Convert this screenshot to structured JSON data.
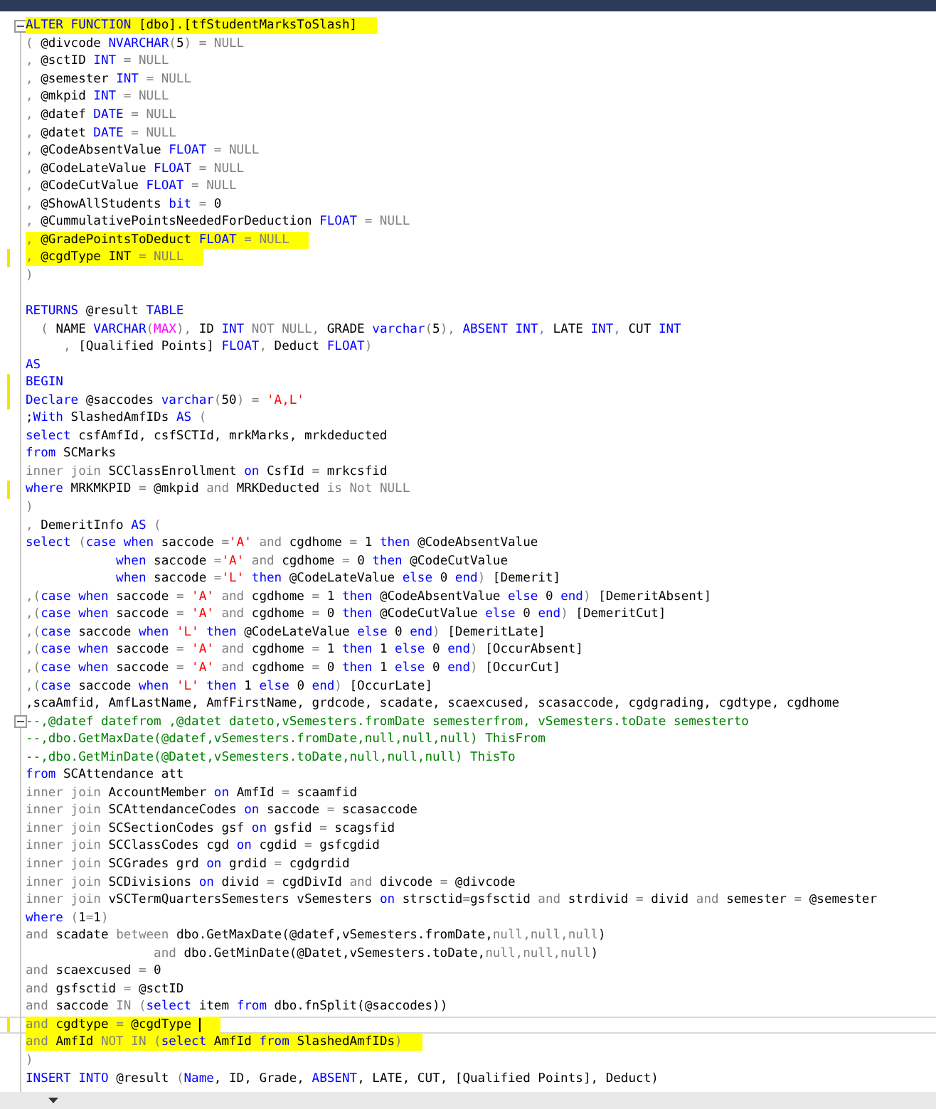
{
  "editor": {
    "lines": [
      {
        "highlighted": true,
        "changed": false,
        "current": false,
        "foldable": true,
        "tokens": [
          {
            "kind": "kw",
            "text": "ALTER FUNCTION"
          },
          {
            "kind": "plain",
            "text": " [dbo].[tfStudentMarksToSlash]"
          }
        ]
      },
      {
        "highlighted": false,
        "changed": false,
        "current": false,
        "foldable": false,
        "tokens": [
          {
            "kind": "gray",
            "text": "( "
          },
          {
            "kind": "plain",
            "text": "@divcode "
          },
          {
            "kind": "kw",
            "text": "NVARCHAR"
          },
          {
            "kind": "gray",
            "text": "("
          },
          {
            "kind": "plain",
            "text": "5"
          },
          {
            "kind": "gray",
            "text": ") = NULL"
          }
        ]
      },
      {
        "highlighted": false,
        "changed": false,
        "current": false,
        "foldable": false,
        "tokens": [
          {
            "kind": "gray",
            "text": ", "
          },
          {
            "kind": "plain",
            "text": "@sctID "
          },
          {
            "kind": "kw",
            "text": "INT"
          },
          {
            "kind": "gray",
            "text": " = NULL"
          }
        ]
      },
      {
        "highlighted": false,
        "changed": false,
        "current": false,
        "foldable": false,
        "tokens": [
          {
            "kind": "gray",
            "text": ", "
          },
          {
            "kind": "plain",
            "text": "@semester "
          },
          {
            "kind": "kw",
            "text": "INT"
          },
          {
            "kind": "gray",
            "text": " = NULL"
          }
        ]
      },
      {
        "highlighted": false,
        "changed": false,
        "current": false,
        "foldable": false,
        "tokens": [
          {
            "kind": "gray",
            "text": ", "
          },
          {
            "kind": "plain",
            "text": "@mkpid "
          },
          {
            "kind": "kw",
            "text": "INT"
          },
          {
            "kind": "gray",
            "text": " = NULL"
          }
        ]
      },
      {
        "highlighted": false,
        "changed": false,
        "current": false,
        "foldable": false,
        "tokens": [
          {
            "kind": "gray",
            "text": ", "
          },
          {
            "kind": "plain",
            "text": "@datef "
          },
          {
            "kind": "kw",
            "text": "DATE"
          },
          {
            "kind": "gray",
            "text": " = NULL"
          }
        ]
      },
      {
        "highlighted": false,
        "changed": false,
        "current": false,
        "foldable": false,
        "tokens": [
          {
            "kind": "gray",
            "text": ", "
          },
          {
            "kind": "plain",
            "text": "@datet "
          },
          {
            "kind": "kw",
            "text": "DATE"
          },
          {
            "kind": "gray",
            "text": " = NULL"
          }
        ]
      },
      {
        "highlighted": false,
        "changed": false,
        "current": false,
        "foldable": false,
        "tokens": [
          {
            "kind": "gray",
            "text": ", "
          },
          {
            "kind": "plain",
            "text": "@CodeAbsentValue "
          },
          {
            "kind": "kw",
            "text": "FLOAT"
          },
          {
            "kind": "gray",
            "text": " = NULL"
          }
        ]
      },
      {
        "highlighted": false,
        "changed": false,
        "current": false,
        "foldable": false,
        "tokens": [
          {
            "kind": "gray",
            "text": ", "
          },
          {
            "kind": "plain",
            "text": "@CodeLateValue "
          },
          {
            "kind": "kw",
            "text": "FLOAT"
          },
          {
            "kind": "gray",
            "text": " = NULL"
          }
        ]
      },
      {
        "highlighted": false,
        "changed": false,
        "current": false,
        "foldable": false,
        "tokens": [
          {
            "kind": "gray",
            "text": ", "
          },
          {
            "kind": "plain",
            "text": "@CodeCutValue "
          },
          {
            "kind": "kw",
            "text": "FLOAT"
          },
          {
            "kind": "gray",
            "text": " = NULL"
          }
        ]
      },
      {
        "highlighted": false,
        "changed": false,
        "current": false,
        "foldable": false,
        "tokens": [
          {
            "kind": "gray",
            "text": ", "
          },
          {
            "kind": "plain",
            "text": "@ShowAllStudents "
          },
          {
            "kind": "kw",
            "text": "bit"
          },
          {
            "kind": "gray",
            "text": " = "
          },
          {
            "kind": "plain",
            "text": "0"
          }
        ]
      },
      {
        "highlighted": false,
        "changed": false,
        "current": false,
        "foldable": false,
        "tokens": [
          {
            "kind": "gray",
            "text": ", "
          },
          {
            "kind": "plain",
            "text": "@CummulativePointsNeededForDeduction "
          },
          {
            "kind": "kw",
            "text": "FLOAT"
          },
          {
            "kind": "gray",
            "text": " = NULL"
          }
        ]
      },
      {
        "highlighted": true,
        "changed": false,
        "current": false,
        "foldable": false,
        "tokens": [
          {
            "kind": "gray",
            "text": ", "
          },
          {
            "kind": "plain",
            "text": "@GradePointsToDeduct "
          },
          {
            "kind": "kw",
            "text": "FLOAT"
          },
          {
            "kind": "gray",
            "text": " = NULL"
          }
        ]
      },
      {
        "highlighted": true,
        "changed": true,
        "current": false,
        "foldable": false,
        "tokens": [
          {
            "kind": "gray",
            "text": ", "
          },
          {
            "kind": "plain",
            "text": "@cgdType INT"
          },
          {
            "kind": "gray",
            "text": " = NULL"
          }
        ]
      },
      {
        "highlighted": false,
        "changed": false,
        "current": false,
        "foldable": false,
        "tokens": [
          {
            "kind": "gray",
            "text": ")"
          }
        ]
      },
      {
        "changed": false,
        "current": false,
        "foldable": false
      },
      {
        "highlighted": false,
        "changed": false,
        "current": false,
        "foldable": false,
        "tokens": [
          {
            "kind": "kw",
            "text": "RETURNS "
          },
          {
            "kind": "plain",
            "text": "@result "
          },
          {
            "kind": "kw",
            "text": "TABLE"
          }
        ]
      },
      {
        "highlighted": false,
        "changed": false,
        "current": false,
        "foldable": false,
        "tokens": [
          {
            "kind": "gray",
            "text": "  ( "
          },
          {
            "kind": "plain",
            "text": "NAME "
          },
          {
            "kind": "kw",
            "text": "VARCHAR"
          },
          {
            "kind": "gray",
            "text": "("
          },
          {
            "kind": "fn",
            "text": "MAX"
          },
          {
            "kind": "gray",
            "text": "), "
          },
          {
            "kind": "plain",
            "text": "ID "
          },
          {
            "kind": "kw",
            "text": "INT "
          },
          {
            "kind": "gray",
            "text": "NOT NULL, "
          },
          {
            "kind": "plain",
            "text": "GRADE "
          },
          {
            "kind": "kw",
            "text": "varchar"
          },
          {
            "kind": "gray",
            "text": "("
          },
          {
            "kind": "plain",
            "text": "5"
          },
          {
            "kind": "gray",
            "text": "), "
          },
          {
            "kind": "kw",
            "text": "ABSENT INT"
          },
          {
            "kind": "gray",
            "text": ", "
          },
          {
            "kind": "plain",
            "text": "LATE "
          },
          {
            "kind": "kw",
            "text": "INT"
          },
          {
            "kind": "gray",
            "text": ", "
          },
          {
            "kind": "plain",
            "text": "CUT "
          },
          {
            "kind": "kw",
            "text": "INT"
          }
        ]
      },
      {
        "highlighted": false,
        "changed": false,
        "current": false,
        "foldable": false,
        "tokens": [
          {
            "kind": "gray",
            "text": "     , "
          },
          {
            "kind": "plain",
            "text": "[Qualified Points] "
          },
          {
            "kind": "kw",
            "text": "FLOAT"
          },
          {
            "kind": "gray",
            "text": ", "
          },
          {
            "kind": "plain",
            "text": "Deduct "
          },
          {
            "kind": "kw",
            "text": "FLOAT"
          },
          {
            "kind": "gray",
            "text": ")"
          }
        ]
      },
      {
        "highlighted": false,
        "changed": false,
        "current": false,
        "foldable": false,
        "tokens": [
          {
            "kind": "kw",
            "text": "AS"
          }
        ]
      },
      {
        "highlighted": false,
        "changed": true,
        "current": false,
        "foldable": false,
        "tokens": [
          {
            "kind": "kw",
            "text": "BEGIN"
          }
        ]
      },
      {
        "highlighted": false,
        "changed": true,
        "current": false,
        "foldable": false,
        "tokens": [
          {
            "kind": "kw",
            "text": "Declare "
          },
          {
            "kind": "plain",
            "text": "@saccodes "
          },
          {
            "kind": "kw",
            "text": "varchar"
          },
          {
            "kind": "gray",
            "text": "("
          },
          {
            "kind": "plain",
            "text": "50"
          },
          {
            "kind": "gray",
            "text": ") = "
          },
          {
            "kind": "str",
            "text": "'A,L'"
          }
        ]
      },
      {
        "highlighted": false,
        "changed": false,
        "current": false,
        "foldable": false,
        "tokens": [
          {
            "kind": "plain",
            "text": ";"
          },
          {
            "kind": "kw",
            "text": "With "
          },
          {
            "kind": "plain",
            "text": "SlashedAmfIDs "
          },
          {
            "kind": "kw",
            "text": "AS "
          },
          {
            "kind": "gray",
            "text": "("
          }
        ]
      },
      {
        "highlighted": false,
        "changed": false,
        "current": false,
        "foldable": false,
        "tokens": [
          {
            "kind": "kw",
            "text": "select "
          },
          {
            "kind": "plain",
            "text": "csfAmfId, csfSCTId, mrkMarks, mrkdeducted"
          }
        ]
      },
      {
        "highlighted": false,
        "changed": false,
        "current": false,
        "foldable": false,
        "tokens": [
          {
            "kind": "kw",
            "text": "from "
          },
          {
            "kind": "plain",
            "text": "SCMarks"
          }
        ]
      },
      {
        "highlighted": false,
        "changed": false,
        "current": false,
        "foldable": false,
        "tokens": [
          {
            "kind": "gray",
            "text": "inner join "
          },
          {
            "kind": "plain",
            "text": "SCClassEnrollment "
          },
          {
            "kind": "kw",
            "text": "on "
          },
          {
            "kind": "plain",
            "text": "CsfId "
          },
          {
            "kind": "gray",
            "text": "= "
          },
          {
            "kind": "plain",
            "text": "mrkcsfid"
          }
        ]
      },
      {
        "highlighted": false,
        "changed": true,
        "current": false,
        "foldable": false,
        "tokens": [
          {
            "kind": "kw",
            "text": "where "
          },
          {
            "kind": "plain",
            "text": "MRKMKPID "
          },
          {
            "kind": "gray",
            "text": "= "
          },
          {
            "kind": "plain",
            "text": "@mkpid "
          },
          {
            "kind": "gray",
            "text": "and "
          },
          {
            "kind": "plain",
            "text": "MRKDeducted "
          },
          {
            "kind": "gray",
            "text": "is Not NULL"
          }
        ]
      },
      {
        "highlighted": false,
        "changed": false,
        "current": false,
        "foldable": false,
        "tokens": [
          {
            "kind": "gray",
            "text": ")"
          }
        ]
      },
      {
        "highlighted": false,
        "changed": false,
        "current": false,
        "foldable": false,
        "tokens": [
          {
            "kind": "gray",
            "text": ", "
          },
          {
            "kind": "plain",
            "text": "DemeritInfo "
          },
          {
            "kind": "kw",
            "text": "AS "
          },
          {
            "kind": "gray",
            "text": "("
          }
        ]
      },
      {
        "highlighted": false,
        "changed": false,
        "current": false,
        "foldable": false,
        "tokens": [
          {
            "kind": "kw",
            "text": "select "
          },
          {
            "kind": "gray",
            "text": "("
          },
          {
            "kind": "kw",
            "text": "case when "
          },
          {
            "kind": "plain",
            "text": "saccode "
          },
          {
            "kind": "gray",
            "text": "="
          },
          {
            "kind": "str",
            "text": "'A' "
          },
          {
            "kind": "gray",
            "text": "and "
          },
          {
            "kind": "plain",
            "text": "cgdhome "
          },
          {
            "kind": "gray",
            "text": "= "
          },
          {
            "kind": "plain",
            "text": "1 "
          },
          {
            "kind": "kw",
            "text": "then "
          },
          {
            "kind": "plain",
            "text": "@CodeAbsentValue"
          }
        ]
      },
      {
        "highlighted": false,
        "changed": false,
        "current": false,
        "foldable": false,
        "tokens": [
          {
            "kind": "kw",
            "text": "            when "
          },
          {
            "kind": "plain",
            "text": "saccode "
          },
          {
            "kind": "gray",
            "text": "="
          },
          {
            "kind": "str",
            "text": "'A' "
          },
          {
            "kind": "gray",
            "text": "and "
          },
          {
            "kind": "plain",
            "text": "cgdhome "
          },
          {
            "kind": "gray",
            "text": "= "
          },
          {
            "kind": "plain",
            "text": "0 "
          },
          {
            "kind": "kw",
            "text": "then "
          },
          {
            "kind": "plain",
            "text": "@CodeCutValue"
          }
        ]
      },
      {
        "highlighted": false,
        "changed": false,
        "current": false,
        "foldable": false,
        "tokens": [
          {
            "kind": "kw",
            "text": "            when "
          },
          {
            "kind": "plain",
            "text": "saccode "
          },
          {
            "kind": "gray",
            "text": "="
          },
          {
            "kind": "str",
            "text": "'L' "
          },
          {
            "kind": "kw",
            "text": "then "
          },
          {
            "kind": "plain",
            "text": "@CodeLateValue "
          },
          {
            "kind": "kw",
            "text": "else "
          },
          {
            "kind": "plain",
            "text": "0 "
          },
          {
            "kind": "kw",
            "text": "end"
          },
          {
            "kind": "gray",
            "text": ") "
          },
          {
            "kind": "plain",
            "text": "[Demerit]"
          }
        ]
      },
      {
        "highlighted": false,
        "changed": false,
        "current": false,
        "foldable": false,
        "tokens": [
          {
            "kind": "gray",
            "text": ",("
          },
          {
            "kind": "kw",
            "text": "case when "
          },
          {
            "kind": "plain",
            "text": "saccode "
          },
          {
            "kind": "gray",
            "text": "= "
          },
          {
            "kind": "str",
            "text": "'A' "
          },
          {
            "kind": "gray",
            "text": "and "
          },
          {
            "kind": "plain",
            "text": "cgdhome "
          },
          {
            "kind": "gray",
            "text": "= "
          },
          {
            "kind": "plain",
            "text": "1 "
          },
          {
            "kind": "kw",
            "text": "then "
          },
          {
            "kind": "plain",
            "text": "@CodeAbsentValue "
          },
          {
            "kind": "kw",
            "text": "else "
          },
          {
            "kind": "plain",
            "text": "0 "
          },
          {
            "kind": "kw",
            "text": "end"
          },
          {
            "kind": "gray",
            "text": ") "
          },
          {
            "kind": "plain",
            "text": "[DemeritAbsent]"
          }
        ]
      },
      {
        "highlighted": false,
        "changed": false,
        "current": false,
        "foldable": false,
        "tokens": [
          {
            "kind": "gray",
            "text": ",("
          },
          {
            "kind": "kw",
            "text": "case when "
          },
          {
            "kind": "plain",
            "text": "saccode "
          },
          {
            "kind": "gray",
            "text": "= "
          },
          {
            "kind": "str",
            "text": "'A' "
          },
          {
            "kind": "gray",
            "text": "and "
          },
          {
            "kind": "plain",
            "text": "cgdhome "
          },
          {
            "kind": "gray",
            "text": "= "
          },
          {
            "kind": "plain",
            "text": "0 "
          },
          {
            "kind": "kw",
            "text": "then "
          },
          {
            "kind": "plain",
            "text": "@CodeCutValue "
          },
          {
            "kind": "kw",
            "text": "else "
          },
          {
            "kind": "plain",
            "text": "0 "
          },
          {
            "kind": "kw",
            "text": "end"
          },
          {
            "kind": "gray",
            "text": ") "
          },
          {
            "kind": "plain",
            "text": "[DemeritCut]"
          }
        ]
      },
      {
        "highlighted": false,
        "changed": false,
        "current": false,
        "foldable": false,
        "tokens": [
          {
            "kind": "gray",
            "text": ",("
          },
          {
            "kind": "kw",
            "text": "case "
          },
          {
            "kind": "plain",
            "text": "saccode "
          },
          {
            "kind": "kw",
            "text": "when "
          },
          {
            "kind": "str",
            "text": "'L' "
          },
          {
            "kind": "kw",
            "text": "then "
          },
          {
            "kind": "plain",
            "text": "@CodeLateValue "
          },
          {
            "kind": "kw",
            "text": "else "
          },
          {
            "kind": "plain",
            "text": "0 "
          },
          {
            "kind": "kw",
            "text": "end"
          },
          {
            "kind": "gray",
            "text": ") "
          },
          {
            "kind": "plain",
            "text": "[DemeritLate]"
          }
        ]
      },
      {
        "highlighted": false,
        "changed": false,
        "current": false,
        "foldable": false,
        "tokens": [
          {
            "kind": "gray",
            "text": ",("
          },
          {
            "kind": "kw",
            "text": "case when "
          },
          {
            "kind": "plain",
            "text": "saccode "
          },
          {
            "kind": "gray",
            "text": "= "
          },
          {
            "kind": "str",
            "text": "'A' "
          },
          {
            "kind": "gray",
            "text": "and "
          },
          {
            "kind": "plain",
            "text": "cgdhome "
          },
          {
            "kind": "gray",
            "text": "= "
          },
          {
            "kind": "plain",
            "text": "1 "
          },
          {
            "kind": "kw",
            "text": "then "
          },
          {
            "kind": "plain",
            "text": "1 "
          },
          {
            "kind": "kw",
            "text": "else "
          },
          {
            "kind": "plain",
            "text": "0 "
          },
          {
            "kind": "kw",
            "text": "end"
          },
          {
            "kind": "gray",
            "text": ") "
          },
          {
            "kind": "plain",
            "text": "[OccurAbsent]"
          }
        ]
      },
      {
        "highlighted": false,
        "changed": false,
        "current": false,
        "foldable": false,
        "tokens": [
          {
            "kind": "gray",
            "text": ",("
          },
          {
            "kind": "kw",
            "text": "case when "
          },
          {
            "kind": "plain",
            "text": "saccode "
          },
          {
            "kind": "gray",
            "text": "= "
          },
          {
            "kind": "str",
            "text": "'A' "
          },
          {
            "kind": "gray",
            "text": "and "
          },
          {
            "kind": "plain",
            "text": "cgdhome "
          },
          {
            "kind": "gray",
            "text": "= "
          },
          {
            "kind": "plain",
            "text": "0 "
          },
          {
            "kind": "kw",
            "text": "then "
          },
          {
            "kind": "plain",
            "text": "1 "
          },
          {
            "kind": "kw",
            "text": "else "
          },
          {
            "kind": "plain",
            "text": "0 "
          },
          {
            "kind": "kw",
            "text": "end"
          },
          {
            "kind": "gray",
            "text": ") "
          },
          {
            "kind": "plain",
            "text": "[OccurCut]"
          }
        ]
      },
      {
        "highlighted": false,
        "changed": false,
        "current": false,
        "foldable": false,
        "tokens": [
          {
            "kind": "gray",
            "text": ",("
          },
          {
            "kind": "kw",
            "text": "case "
          },
          {
            "kind": "plain",
            "text": "saccode "
          },
          {
            "kind": "kw",
            "text": "when "
          },
          {
            "kind": "str",
            "text": "'L' "
          },
          {
            "kind": "kw",
            "text": "then "
          },
          {
            "kind": "plain",
            "text": "1 "
          },
          {
            "kind": "kw",
            "text": "else "
          },
          {
            "kind": "plain",
            "text": "0 "
          },
          {
            "kind": "kw",
            "text": "end"
          },
          {
            "kind": "gray",
            "text": ") "
          },
          {
            "kind": "plain",
            "text": "[OccurLate]"
          }
        ]
      },
      {
        "highlighted": false,
        "changed": false,
        "current": false,
        "foldable": false,
        "tokens": [
          {
            "kind": "plain",
            "text": ",scaAmfid, AmfLastName, AmfFirstName, grdcode, scadate, scaexcused, scasaccode, cgdgrading, cgdtype, cgdhome"
          }
        ]
      },
      {
        "highlighted": false,
        "changed": false,
        "current": false,
        "foldable": true,
        "tokens": [
          {
            "kind": "comment",
            "text": "--,@datef datefrom ,@datet dateto,vSemesters.fromDate semesterfrom, vSemesters.toDate semesterto"
          }
        ]
      },
      {
        "highlighted": false,
        "changed": false,
        "current": false,
        "foldable": false,
        "tokens": [
          {
            "kind": "comment",
            "text": "--,dbo.GetMaxDate(@datef,vSemesters.fromDate,null,null,null) ThisFrom"
          }
        ]
      },
      {
        "highlighted": false,
        "changed": false,
        "current": false,
        "foldable": false,
        "tokens": [
          {
            "kind": "comment",
            "text": "--,dbo.GetMinDate(@Datet,vSemesters.toDate,null,null,null) ThisTo"
          }
        ]
      },
      {
        "highlighted": false,
        "changed": false,
        "current": false,
        "foldable": false,
        "tokens": [
          {
            "kind": "kw",
            "text": "from "
          },
          {
            "kind": "plain",
            "text": "SCAttendance att"
          }
        ]
      },
      {
        "highlighted": false,
        "changed": false,
        "current": false,
        "foldable": false,
        "tokens": [
          {
            "kind": "gray",
            "text": "inner join "
          },
          {
            "kind": "plain",
            "text": "AccountMember "
          },
          {
            "kind": "kw",
            "text": "on "
          },
          {
            "kind": "plain",
            "text": "AmfId "
          },
          {
            "kind": "gray",
            "text": "= "
          },
          {
            "kind": "plain",
            "text": "scaamfid"
          }
        ]
      },
      {
        "highlighted": false,
        "changed": false,
        "current": false,
        "foldable": false,
        "tokens": [
          {
            "kind": "gray",
            "text": "inner join "
          },
          {
            "kind": "plain",
            "text": "SCAttendanceCodes "
          },
          {
            "kind": "kw",
            "text": "on "
          },
          {
            "kind": "plain",
            "text": "saccode "
          },
          {
            "kind": "gray",
            "text": "= "
          },
          {
            "kind": "plain",
            "text": "scasaccode"
          }
        ]
      },
      {
        "highlighted": false,
        "changed": false,
        "current": false,
        "foldable": false,
        "tokens": [
          {
            "kind": "gray",
            "text": "inner join "
          },
          {
            "kind": "plain",
            "text": "SCSectionCodes gsf "
          },
          {
            "kind": "kw",
            "text": "on "
          },
          {
            "kind": "plain",
            "text": "gsfid "
          },
          {
            "kind": "gray",
            "text": "= "
          },
          {
            "kind": "plain",
            "text": "scagsfid"
          }
        ]
      },
      {
        "highlighted": false,
        "changed": false,
        "current": false,
        "foldable": false,
        "tokens": [
          {
            "kind": "gray",
            "text": "inner join "
          },
          {
            "kind": "plain",
            "text": "SCClassCodes cgd "
          },
          {
            "kind": "kw",
            "text": "on "
          },
          {
            "kind": "plain",
            "text": "cgdid "
          },
          {
            "kind": "gray",
            "text": "= "
          },
          {
            "kind": "plain",
            "text": "gsfcgdid"
          }
        ]
      },
      {
        "highlighted": false,
        "changed": false,
        "current": false,
        "foldable": false,
        "tokens": [
          {
            "kind": "gray",
            "text": "inner join "
          },
          {
            "kind": "plain",
            "text": "SCGrades grd "
          },
          {
            "kind": "kw",
            "text": "on "
          },
          {
            "kind": "plain",
            "text": "grdid "
          },
          {
            "kind": "gray",
            "text": "= "
          },
          {
            "kind": "plain",
            "text": "cgdgrdid"
          }
        ]
      },
      {
        "highlighted": false,
        "changed": false,
        "current": false,
        "foldable": false,
        "tokens": [
          {
            "kind": "gray",
            "text": "inner join "
          },
          {
            "kind": "plain",
            "text": "SCDivisions "
          },
          {
            "kind": "kw",
            "text": "on "
          },
          {
            "kind": "plain",
            "text": "divid "
          },
          {
            "kind": "gray",
            "text": "= "
          },
          {
            "kind": "plain",
            "text": "cgdDivId "
          },
          {
            "kind": "gray",
            "text": "and "
          },
          {
            "kind": "plain",
            "text": "divcode "
          },
          {
            "kind": "gray",
            "text": "= "
          },
          {
            "kind": "plain",
            "text": "@divcode"
          }
        ]
      },
      {
        "highlighted": false,
        "changed": false,
        "current": false,
        "foldable": false,
        "tokens": [
          {
            "kind": "gray",
            "text": "inner join "
          },
          {
            "kind": "plain",
            "text": "vSCTermQuartersSemesters vSemesters "
          },
          {
            "kind": "kw",
            "text": "on "
          },
          {
            "kind": "plain",
            "text": "strsctid"
          },
          {
            "kind": "gray",
            "text": "="
          },
          {
            "kind": "plain",
            "text": "gsfsctid "
          },
          {
            "kind": "gray",
            "text": "and "
          },
          {
            "kind": "plain",
            "text": "strdivid "
          },
          {
            "kind": "gray",
            "text": "= "
          },
          {
            "kind": "plain",
            "text": "divid "
          },
          {
            "kind": "gray",
            "text": "and "
          },
          {
            "kind": "plain",
            "text": "semester "
          },
          {
            "kind": "gray",
            "text": "= "
          },
          {
            "kind": "plain",
            "text": "@semester"
          }
        ]
      },
      {
        "highlighted": false,
        "changed": false,
        "current": false,
        "foldable": false,
        "tokens": [
          {
            "kind": "kw",
            "text": "where "
          },
          {
            "kind": "gray",
            "text": "("
          },
          {
            "kind": "plain",
            "text": "1"
          },
          {
            "kind": "gray",
            "text": "="
          },
          {
            "kind": "plain",
            "text": "1"
          },
          {
            "kind": "gray",
            "text": ")"
          }
        ]
      },
      {
        "highlighted": false,
        "changed": false,
        "current": false,
        "foldable": false,
        "tokens": [
          {
            "kind": "gray",
            "text": "and "
          },
          {
            "kind": "plain",
            "text": "scadate "
          },
          {
            "kind": "gray",
            "text": "between "
          },
          {
            "kind": "plain",
            "text": "dbo.GetMaxDate(@datef,vSemesters.fromDate,"
          },
          {
            "kind": "gray",
            "text": "null,null,null"
          },
          {
            "kind": "plain",
            "text": ")"
          }
        ]
      },
      {
        "highlighted": false,
        "changed": false,
        "current": false,
        "foldable": false,
        "tokens": [
          {
            "kind": "gray",
            "text": "                 and "
          },
          {
            "kind": "plain",
            "text": "dbo.GetMinDate(@Datet,vSemesters.toDate,"
          },
          {
            "kind": "gray",
            "text": "null,null,null"
          },
          {
            "kind": "plain",
            "text": ")"
          }
        ]
      },
      {
        "highlighted": false,
        "changed": false,
        "current": false,
        "foldable": false,
        "tokens": [
          {
            "kind": "gray",
            "text": "and "
          },
          {
            "kind": "plain",
            "text": "scaexcused "
          },
          {
            "kind": "gray",
            "text": "= "
          },
          {
            "kind": "plain",
            "text": "0"
          }
        ]
      },
      {
        "highlighted": false,
        "changed": false,
        "current": false,
        "foldable": false,
        "tokens": [
          {
            "kind": "gray",
            "text": "and "
          },
          {
            "kind": "plain",
            "text": "gsfsctid "
          },
          {
            "kind": "gray",
            "text": "= "
          },
          {
            "kind": "plain",
            "text": "@sctID"
          }
        ]
      },
      {
        "highlighted": false,
        "changed": false,
        "current": false,
        "foldable": false,
        "tokens": [
          {
            "kind": "gray",
            "text": "and "
          },
          {
            "kind": "plain",
            "text": "saccode "
          },
          {
            "kind": "gray",
            "text": "IN ("
          },
          {
            "kind": "kw",
            "text": "select "
          },
          {
            "kind": "plain",
            "text": "item "
          },
          {
            "kind": "kw",
            "text": "from "
          },
          {
            "kind": "plain",
            "text": "dbo.fnSplit(@saccodes))"
          }
        ]
      },
      {
        "highlighted": true,
        "changed": true,
        "current": true,
        "foldable": false,
        "tokens": [
          {
            "kind": "gray",
            "text": "and "
          },
          {
            "kind": "plain",
            "text": "cgdtype "
          },
          {
            "kind": "gray",
            "text": "= "
          },
          {
            "kind": "plain",
            "text": "@cgdType "
          }
        ]
      },
      {
        "highlighted": true,
        "changed": false,
        "current": false,
        "foldable": false,
        "tokens": [
          {
            "kind": "gray",
            "text": "and "
          },
          {
            "kind": "plain",
            "text": "AmfId "
          },
          {
            "kind": "gray",
            "text": "NOT IN ("
          },
          {
            "kind": "kw",
            "text": "select "
          },
          {
            "kind": "plain",
            "text": "AmfId "
          },
          {
            "kind": "kw",
            "text": "from "
          },
          {
            "kind": "plain",
            "text": "SlashedAmfIDs"
          },
          {
            "kind": "gray",
            "text": ")"
          }
        ]
      },
      {
        "highlighted": false,
        "changed": false,
        "current": false,
        "foldable": false,
        "tokens": [
          {
            "kind": "gray",
            "text": ")"
          }
        ]
      },
      {
        "highlighted": false,
        "changed": false,
        "current": false,
        "foldable": false,
        "tokens": [
          {
            "kind": "kw",
            "text": "INSERT INTO "
          },
          {
            "kind": "plain",
            "text": "@result "
          },
          {
            "kind": "gray",
            "text": "("
          },
          {
            "kind": "kw",
            "text": "Name"
          },
          {
            "kind": "plain",
            "text": ", ID, Grade, "
          },
          {
            "kind": "kw",
            "text": "ABSENT"
          },
          {
            "kind": "plain",
            "text": ", LATE, CUT, [Qualified Points], Deduct)"
          }
        ]
      }
    ]
  }
}
